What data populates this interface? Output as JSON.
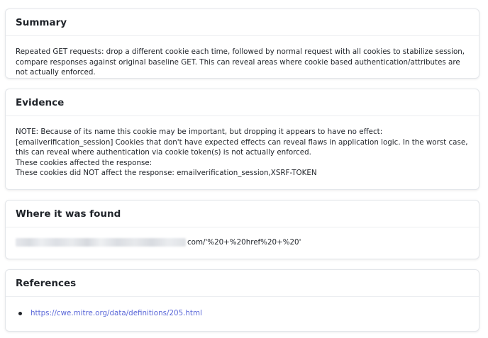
{
  "summary": {
    "title": "Summary",
    "text": "Repeated GET requests: drop a different cookie each time, followed by normal request with all cookies to stabilize session, compare responses against original baseline GET. This can reveal areas where cookie based authentication/attributes are not actually enforced."
  },
  "evidence": {
    "title": "Evidence",
    "lines": [
      "NOTE: Because of its name this cookie may be important, but dropping it appears to have no effect: [emailverification_session] Cookies that don't have expected effects can reveal flaws in application logic. In the worst case, this can reveal where authentication via cookie token(s) is not actually enforced.",
      "These cookies affected the response:",
      "These cookies did NOT affect the response: emailverification_session,XSRF-TOKEN"
    ]
  },
  "found": {
    "title": "Where it was found",
    "url_suffix": "com/'%20+%20href%20+%20'"
  },
  "references": {
    "title": "References",
    "links": [
      "https://cwe.mitre.org/data/definitions/205.html"
    ]
  },
  "colors": {
    "link": "#5a67d8",
    "border": "#e3e6ea",
    "text": "#1f2329"
  }
}
